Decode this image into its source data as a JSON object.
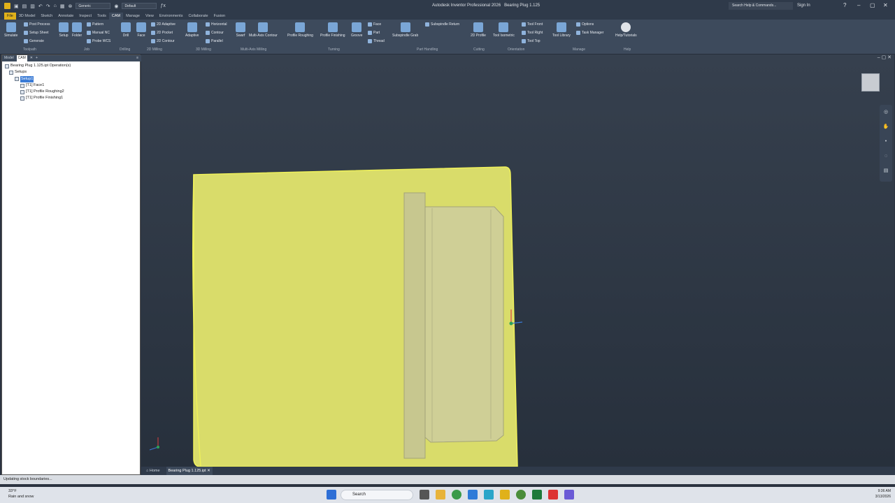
{
  "titlebar": {
    "title": "Autodesk Inventor Professional 2026",
    "document": "Bearing Plug 1.125",
    "material": "Generic",
    "appearance": "Default",
    "search_placeholder": "Search Help & Commands...",
    "signin": "Sign In"
  },
  "tabs": [
    "File",
    "3D Model",
    "Sketch",
    "Annotate",
    "Inspect",
    "Tools",
    "CAM",
    "Manage",
    "View",
    "Environments",
    "Collaborate",
    "Fusion"
  ],
  "ribbon": {
    "simulate": "Simulate",
    "post_process": "Post Process",
    "setup_sheet": "Setup Sheet",
    "generate": "Generate",
    "setup": "Setup",
    "folder": "Folder",
    "pattern": "Pattern",
    "manual_nc": "Manual NC",
    "probe_wcs": "Probe WCS",
    "drill": "Drill",
    "face": "Face",
    "adaptive_2d": "2D Adaptive",
    "pocket_2d": "2D Pocket",
    "contour_2d": "2D Contour",
    "adaptive": "Adaptive",
    "horizontal": "Horizontal",
    "contour": "Contour",
    "parallel": "Parallel",
    "swarf": "Swarf",
    "multi_axis_contour": "Multi-Axis Contour",
    "profile_roughing": "Profile Roughing",
    "profile_finishing": "Profile Finishing",
    "groove": "Groove",
    "turn_face": "Face",
    "part": "Part",
    "thread": "Thread",
    "subspindle_grab": "Subspindle Grab",
    "subspindle_return": "Subspindle Return",
    "profile_2d": "2D Profile",
    "tool_isometric": "Tool Isometric",
    "tool_front": "Tool Front",
    "tool_right": "Tool Right",
    "tool_top": "Tool Top",
    "tool_library": "Tool Library",
    "options": "Options",
    "task_manager": "Task Manager",
    "help_tutorials": "Help/Tutorials",
    "groups": {
      "toolpath": "Toolpath",
      "job": "Job",
      "drilling": "Drilling",
      "milling_2d": "2D Milling",
      "milling_3d": "3D Milling",
      "multi_axis": "Multi-Axis Milling",
      "turning": "Turning",
      "part_handling": "Part Handling",
      "cutting": "Cutting",
      "orientation": "Orientation",
      "manage": "Manage",
      "help": "Help"
    }
  },
  "panel": {
    "tabs": [
      "Model",
      "CAM"
    ],
    "root": "Bearing Plug 1.125.ipt Operation(s)",
    "setups": "Setups",
    "setup1": "Setup1",
    "ops": [
      "[T1] Face1",
      "[T1] Profile Roughing2",
      "[T1] Profile Finishing1"
    ]
  },
  "doc_tabs": {
    "home": "Home",
    "file": "Bearing Plug 1.125.ipt"
  },
  "status": "Updating stock boundaries...",
  "taskbar": {
    "temp": "33°F",
    "weather": "Rain and snow",
    "search": "Search",
    "time": "9:36 AM",
    "date": "3/13/2026"
  },
  "colors": {
    "stock": "#d9dc6a",
    "part": "#c7c78f",
    "accent": "#e0b11a"
  }
}
